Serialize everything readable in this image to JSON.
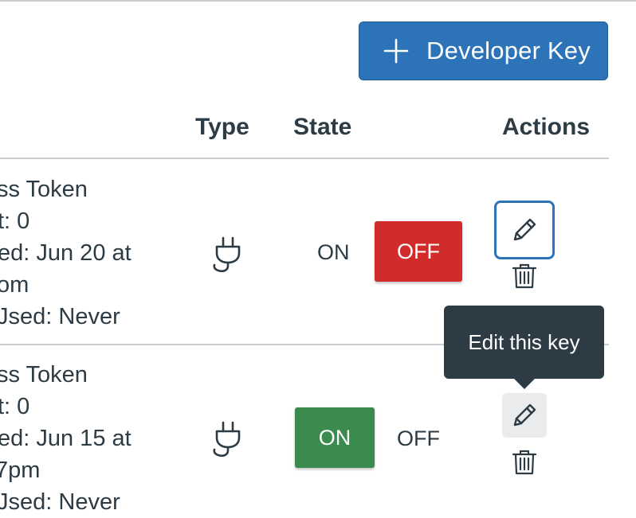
{
  "toolbar": {
    "add_key_label": "Developer Key"
  },
  "table": {
    "headers": {
      "type": "Type",
      "state": "State",
      "actions": "Actions"
    },
    "rows": [
      {
        "details": [
          "ss Token",
          "t: 0",
          "ed: Jun 20 at",
          "om",
          "Jsed: Never"
        ],
        "type_icon": "plug-icon",
        "state_on_label": "ON",
        "state_off_label": "OFF",
        "active_state": "OFF"
      },
      {
        "details": [
          "ss Token",
          "t: 0",
          "ed: Jun 15 at",
          "7pm",
          "Jsed: Never"
        ],
        "type_icon": "plug-icon",
        "state_on_label": "ON",
        "state_off_label": "OFF",
        "active_state": "ON"
      }
    ]
  },
  "tooltip": {
    "text": "Edit this key"
  },
  "colors": {
    "primary": "#2d73b8",
    "off_active": "#d12b2b",
    "on_active": "#3b8a4e",
    "tooltip_bg": "#2d3b45",
    "text": "#2d3b45",
    "divider": "#c7cdd1"
  }
}
